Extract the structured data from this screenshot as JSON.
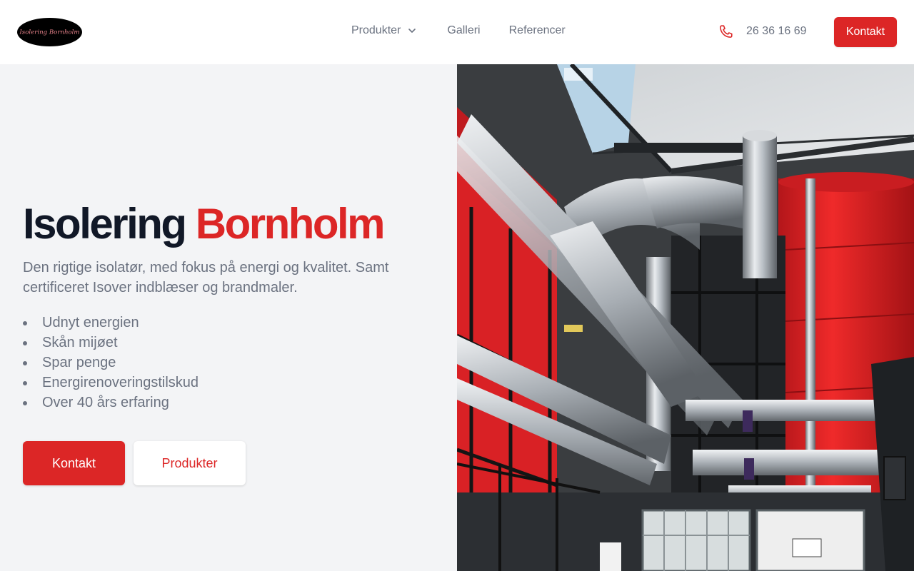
{
  "brand": {
    "logo_text": "Isolering Bornholm",
    "accent_color": "#dc2626"
  },
  "nav": {
    "items": [
      {
        "label": "Produkter",
        "has_dropdown": true
      },
      {
        "label": "Galleri"
      },
      {
        "label": "Referencer"
      }
    ]
  },
  "header": {
    "phone": "26 36 16 69",
    "phone_icon": "phone-icon",
    "cta_label": "Kontakt"
  },
  "hero": {
    "title_main": "Isolering",
    "title_accent": "Bornholm",
    "subtitle": "Den rigtige isolatør, med fokus på energi og kvalitet. Samt certificeret Isover indblæser og brandmaler.",
    "features": [
      "Udnyt energien",
      "Skån mijøet",
      "Spar penge",
      "Energirenoveringstilskud",
      "Over 40 års erfaring"
    ],
    "primary_button": "Kontakt",
    "secondary_button": "Produkter",
    "image_subject": "industrial boiler room with insulated pipes"
  }
}
